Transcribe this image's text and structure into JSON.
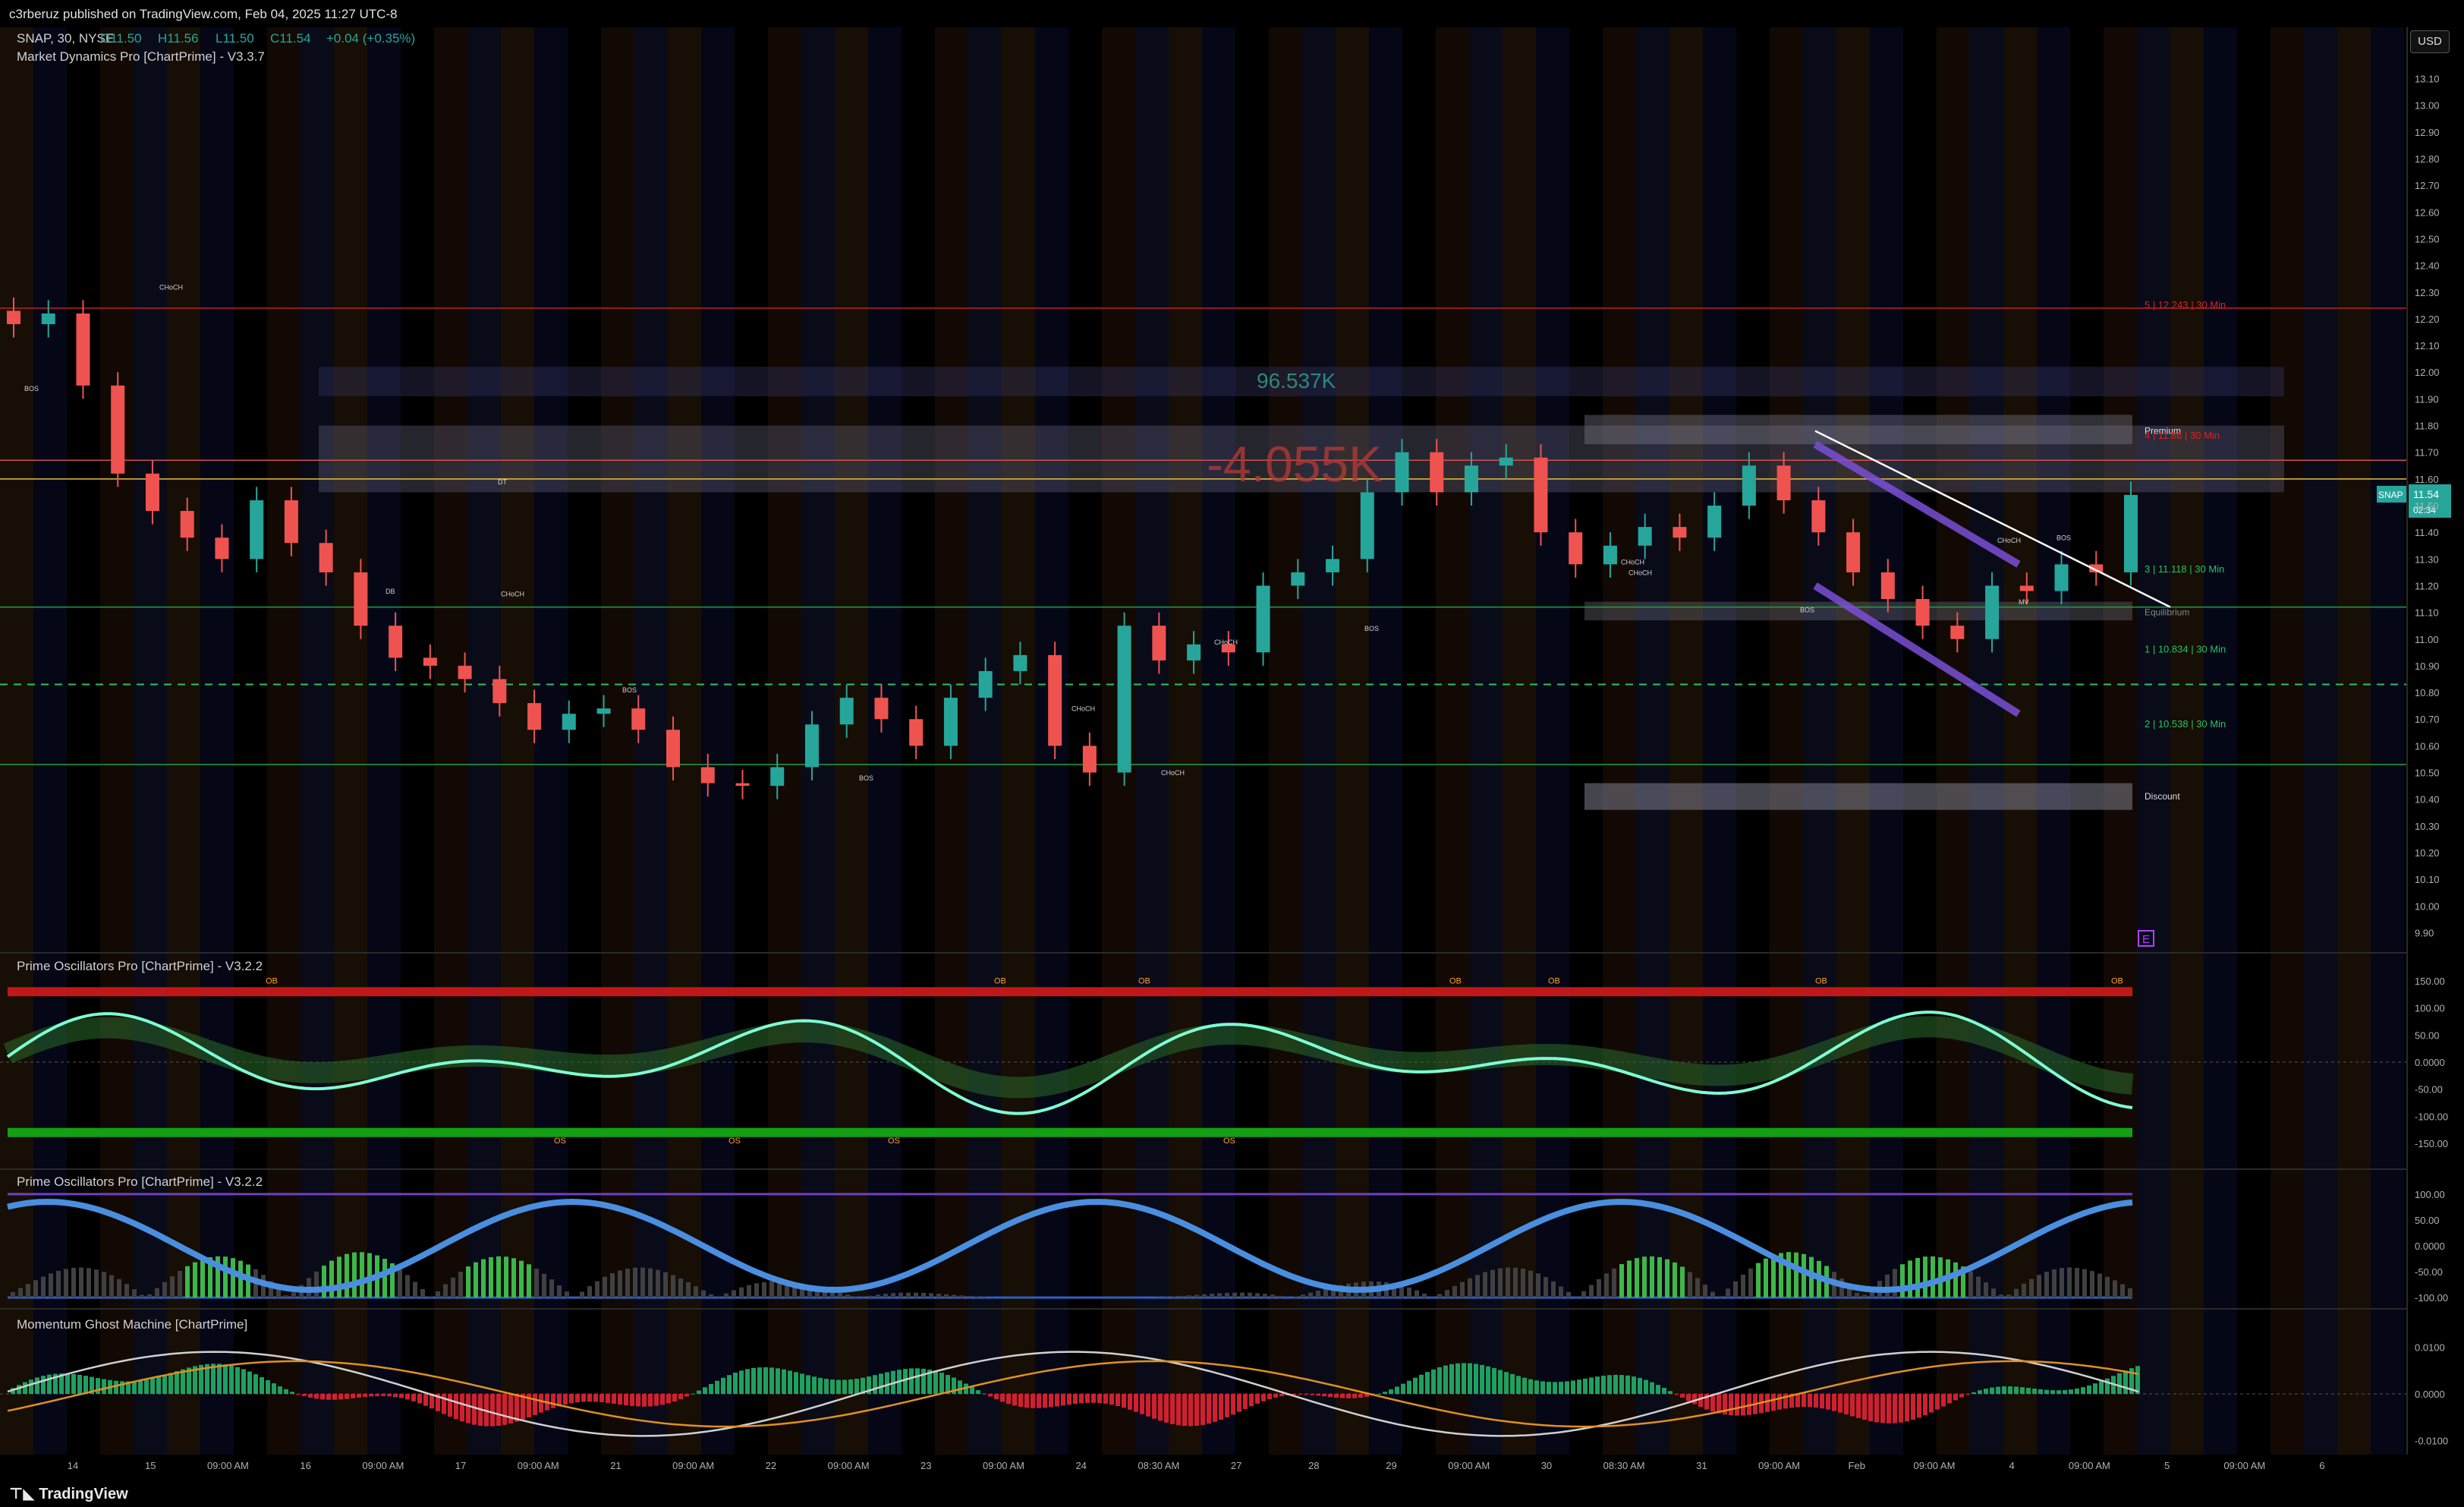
{
  "header": {
    "published": "c3rberuz published on TradingView.com, Feb 04, 2025 11:27 UTC-8",
    "symbol_line": "SNAP, 30, NYSE",
    "ohlc": {
      "o": "O11.50",
      "h": "H11.56",
      "l": "L11.50",
      "c": "C11.54",
      "chg": "+0.04 (+0.35%)"
    },
    "indicator": "Market Dynamics Pro [ChartPrime] - V3.3.7"
  },
  "currency_button": "USD",
  "footer": {
    "logo": "TradingView"
  },
  "colors": {
    "bg": "#000000",
    "up": "#26a69a",
    "down": "#ef5350",
    "premium": "#9a9ab0",
    "osc_up": "#7fffd4",
    "osc_dn": "#ff5a6e"
  },
  "main_chart": {
    "price_axis": [
      "13.10",
      "13.00",
      "12.90",
      "12.80",
      "12.70",
      "12.60",
      "12.50",
      "12.40",
      "12.30",
      "12.20",
      "12.10",
      "12.00",
      "11.90",
      "11.80",
      "11.70",
      "11.60",
      "11.50",
      "11.40",
      "11.30",
      "11.20",
      "11.10",
      "11.00",
      "10.90",
      "10.80",
      "10.70",
      "10.60",
      "10.50",
      "10.40",
      "10.30",
      "10.20",
      "10.10",
      "10.00",
      "9.90"
    ],
    "price_tag": {
      "symbol": "SNAP",
      "price": "11.54",
      "countdown": "02:34"
    },
    "volume_profile": {
      "upper": "96.537K",
      "lower": "-4.055K"
    },
    "zone_labels": {
      "premium": "Premium",
      "discount": "Discount",
      "equilibrium": "Equilibrium"
    },
    "levels": [
      {
        "text": "5  |  12.243  |  30 Min",
        "color": "#e02020"
      },
      {
        "text": "4  |  11.86  |  30 Min",
        "color": "#e02020"
      },
      {
        "text": "3  |  11.118  |  30 Min",
        "color": "#22c55e"
      },
      {
        "text": "1  |  10.834  |  30 Min",
        "color": "#22c55e"
      },
      {
        "text": "2  |  10.538  |  30 Min",
        "color": "#22c55e"
      }
    ],
    "structure_labels": [
      "CHoCH",
      "BOS",
      "DT",
      "DB",
      "CHoCH",
      "BOS",
      "CHoCH",
      "CHoCH",
      "CHoCH",
      "BOS",
      "BOS",
      "CHoCH",
      "CHoCH",
      "BOS",
      "BOS",
      "CHoCH",
      "MV"
    ],
    "badge": "E"
  },
  "pane1": {
    "title": "Prime Oscillators Pro [ChartPrime] - V3.2.2",
    "axis": [
      "150.00",
      "100.00",
      "50.00",
      "0.0000",
      "-50.00",
      "-100.00",
      "-150.00"
    ],
    "ob_label": "OB",
    "os_label": "OS"
  },
  "pane2": {
    "title": "Prime Oscillators Pro [ChartPrime] - V3.2.2",
    "axis": [
      "100.00",
      "50.00",
      "0.0000",
      "-50.00",
      "-100.00"
    ]
  },
  "pane3": {
    "title": "Momentum Ghost Machine [ChartPrime]",
    "axis": [
      "0.0100",
      "0.0000",
      "-0.0100"
    ]
  },
  "time_axis": [
    "14",
    "15",
    "09:00 AM",
    "16",
    "09:00 AM",
    "17",
    "09:00 AM",
    "21",
    "09:00 AM",
    "22",
    "09:00 AM",
    "23",
    "09:00 AM",
    "24",
    "08:30 AM",
    "27",
    "28",
    "29",
    "09:00 AM",
    "30",
    "08:30 AM",
    "31",
    "09:00 AM",
    "Feb",
    "09:00 AM",
    "4",
    "09:00 AM",
    "5",
    "09:00 AM",
    "6"
  ],
  "chart_data": {
    "type": "candlestick",
    "title": "SNAP, 30, NYSE",
    "ylim": [
      9.85,
      13.15
    ],
    "x": [
      "14",
      "15",
      "16",
      "17",
      "21",
      "22",
      "23",
      "24",
      "27",
      "28",
      "29",
      "30",
      "31",
      "Feb",
      "4"
    ],
    "series": [
      {
        "name": "SNAP",
        "close": [
          12.18,
          12.22,
          11.95,
          11.62,
          11.48,
          11.38,
          11.3,
          11.52,
          11.36,
          11.25,
          11.05,
          10.93,
          10.9,
          10.85,
          10.76,
          10.66,
          10.72,
          10.74,
          10.66,
          10.52,
          10.46,
          10.45,
          10.52,
          10.68,
          10.78,
          10.7,
          10.6,
          10.78,
          10.88,
          10.94,
          10.6,
          10.5,
          11.05,
          10.92,
          10.98,
          10.95,
          11.2,
          11.25,
          11.3,
          11.55,
          11.7,
          11.55,
          11.65,
          11.68,
          11.4,
          11.28,
          11.35,
          11.42,
          11.38,
          11.5,
          11.65,
          11.52,
          11.4,
          11.25,
          11.15,
          11.05,
          11.0,
          11.2,
          11.18,
          11.28,
          11.25,
          11.54
        ]
      }
    ]
  }
}
